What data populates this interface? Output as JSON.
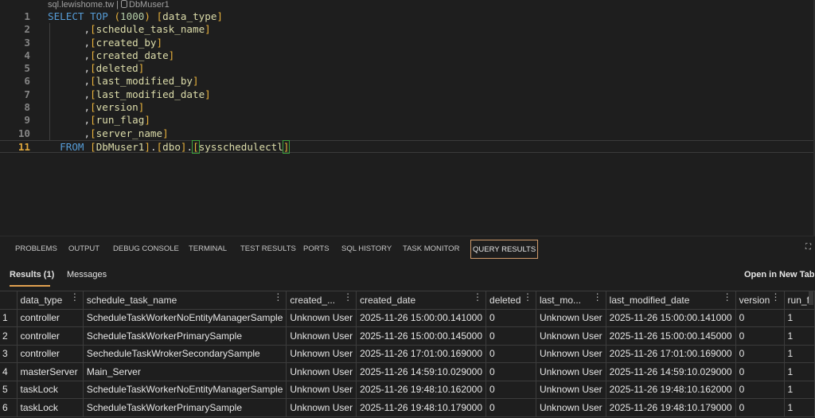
{
  "breadcrumb": {
    "host": "sql.lewishome.tw",
    "separator": "|",
    "database": "DbMuser1"
  },
  "editor": {
    "lines": [
      {
        "n": "1",
        "tokens": [
          {
            "c": "kw",
            "t": "SELECT"
          },
          {
            "c": "punc",
            "t": " "
          },
          {
            "c": "kw",
            "t": "TOP"
          },
          {
            "c": "punc",
            "t": " "
          },
          {
            "c": "br",
            "t": "("
          },
          {
            "c": "num",
            "t": "1000"
          },
          {
            "c": "br",
            "t": ")"
          },
          {
            "c": "punc",
            "t": " "
          },
          {
            "c": "br",
            "t": "["
          },
          {
            "c": "id",
            "t": "data_type"
          },
          {
            "c": "br",
            "t": "]"
          }
        ]
      },
      {
        "n": "2",
        "tokens": [
          {
            "c": "punc",
            "t": "      ,"
          },
          {
            "c": "br",
            "t": "["
          },
          {
            "c": "id",
            "t": "schedule_task_name"
          },
          {
            "c": "br",
            "t": "]"
          }
        ]
      },
      {
        "n": "3",
        "tokens": [
          {
            "c": "punc",
            "t": "      ,"
          },
          {
            "c": "br",
            "t": "["
          },
          {
            "c": "id",
            "t": "created_by"
          },
          {
            "c": "br",
            "t": "]"
          }
        ]
      },
      {
        "n": "4",
        "tokens": [
          {
            "c": "punc",
            "t": "      ,"
          },
          {
            "c": "br",
            "t": "["
          },
          {
            "c": "id",
            "t": "created_date"
          },
          {
            "c": "br",
            "t": "]"
          }
        ]
      },
      {
        "n": "5",
        "tokens": [
          {
            "c": "punc",
            "t": "      ,"
          },
          {
            "c": "br",
            "t": "["
          },
          {
            "c": "id",
            "t": "deleted"
          },
          {
            "c": "br",
            "t": "]"
          }
        ]
      },
      {
        "n": "6",
        "tokens": [
          {
            "c": "punc",
            "t": "      ,"
          },
          {
            "c": "br",
            "t": "["
          },
          {
            "c": "id",
            "t": "last_modified_by"
          },
          {
            "c": "br",
            "t": "]"
          }
        ]
      },
      {
        "n": "7",
        "tokens": [
          {
            "c": "punc",
            "t": "      ,"
          },
          {
            "c": "br",
            "t": "["
          },
          {
            "c": "id",
            "t": "last_modified_date"
          },
          {
            "c": "br",
            "t": "]"
          }
        ]
      },
      {
        "n": "8",
        "tokens": [
          {
            "c": "punc",
            "t": "      ,"
          },
          {
            "c": "br",
            "t": "["
          },
          {
            "c": "id",
            "t": "version"
          },
          {
            "c": "br",
            "t": "]"
          }
        ]
      },
      {
        "n": "9",
        "tokens": [
          {
            "c": "punc",
            "t": "      ,"
          },
          {
            "c": "br",
            "t": "["
          },
          {
            "c": "id",
            "t": "run_flag"
          },
          {
            "c": "br",
            "t": "]"
          }
        ]
      },
      {
        "n": "10",
        "tokens": [
          {
            "c": "punc",
            "t": "      ,"
          },
          {
            "c": "br",
            "t": "["
          },
          {
            "c": "id",
            "t": "server_name"
          },
          {
            "c": "br",
            "t": "]"
          }
        ]
      },
      {
        "n": "11",
        "tokens": [
          {
            "c": "punc",
            "t": "  "
          },
          {
            "c": "kw",
            "t": "FROM"
          },
          {
            "c": "punc",
            "t": " "
          },
          {
            "c": "br",
            "t": "["
          },
          {
            "c": "id",
            "t": "DbMuser1"
          },
          {
            "c": "br",
            "t": "]"
          },
          {
            "c": "punc",
            "t": "."
          },
          {
            "c": "br",
            "t": "["
          },
          {
            "c": "id",
            "t": "dbo"
          },
          {
            "c": "br",
            "t": "]"
          },
          {
            "c": "punc",
            "t": "."
          },
          {
            "c": "br",
            "t": "[",
            "box": true
          },
          {
            "c": "id",
            "t": "sysschedulectl"
          },
          {
            "c": "br",
            "t": "]",
            "box": true
          }
        ]
      }
    ],
    "current_line": "11"
  },
  "panel": {
    "tabs": [
      "PROBLEMS",
      "OUTPUT",
      "DEBUG CONSOLE",
      "TERMINAL",
      "TEST RESULTS",
      "PORTS",
      "SQL HISTORY",
      "TASK MONITOR",
      "QUERY RESULTS"
    ],
    "active_tab": "QUERY RESULTS",
    "subtabs": {
      "results": "Results (1)",
      "messages": "Messages"
    },
    "open_new_tab": "Open in New Tab",
    "columns": [
      "data_type",
      "schedule_task_name",
      "created_...",
      "created_date",
      "deleted",
      "last_mo...",
      "last_modified_date",
      "version",
      "run_f"
    ],
    "rows": [
      [
        "1",
        "controller",
        "ScheduleTaskWorkerNoEntityManagerSample",
        "Unknown User",
        "2025-11-26 15:00:00.141000",
        "0",
        "Unknown User",
        "2025-11-26 15:00:00.141000",
        "0",
        "1"
      ],
      [
        "2",
        "controller",
        "ScheduleTaskWorkerPrimarySample",
        "Unknown User",
        "2025-11-26 15:00:00.145000",
        "0",
        "Unknown User",
        "2025-11-26 15:00:00.145000",
        "0",
        "1"
      ],
      [
        "3",
        "controller",
        "SecheduleTaskWrokerSecondarySample",
        "Unknown User",
        "2025-11-26 17:01:00.169000",
        "0",
        "Unknown User",
        "2025-11-26 17:01:00.169000",
        "0",
        "1"
      ],
      [
        "4",
        "masterServer",
        "Main_Server",
        "Unknown User",
        "2025-11-26 14:59:10.029000",
        "0",
        "Unknown User",
        "2025-11-26 14:59:10.029000",
        "0",
        "1"
      ],
      [
        "5",
        "taskLock",
        "ScheduleTaskWorkerNoEntityManagerSample",
        "Unknown User",
        "2025-11-26 19:48:10.162000",
        "0",
        "Unknown User",
        "2025-11-26 19:48:10.162000",
        "0",
        "1"
      ],
      [
        "6",
        "taskLock",
        "ScheduleTaskWorkerPrimarySample",
        "Unknown User",
        "2025-11-26 19:48:10.179000",
        "0",
        "Unknown User",
        "2025-11-26 19:48:10.179000",
        "0",
        "1"
      ]
    ]
  },
  "colors": {
    "accent": "#e0a050",
    "keyword": "#569cd6",
    "bracket": "#e8b23c",
    "identifier": "#dcdcaa",
    "background": "#1e1e1e"
  }
}
